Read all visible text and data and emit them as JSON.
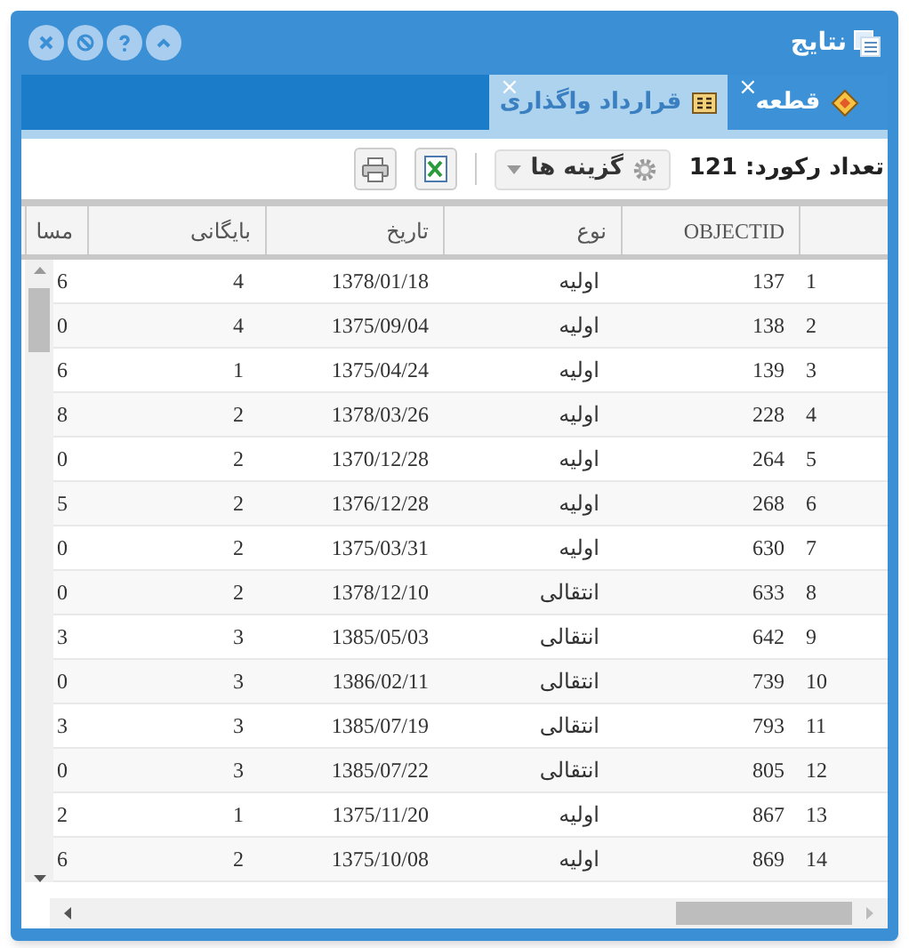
{
  "window": {
    "title": "نتایج"
  },
  "tabs": [
    {
      "label": "قطعه",
      "selected": false,
      "close": "×"
    },
    {
      "label": "قرارداد واگذاری",
      "selected": true,
      "close": "×"
    }
  ],
  "toolbar": {
    "record_count": "تعداد رکورد: 121",
    "options_button": "گزینه ها"
  },
  "table": {
    "columns": [
      "",
      "OBJECTID",
      "نوع",
      "تاریخ",
      "بایگانی",
      "مسا"
    ],
    "rows": [
      [
        "1",
        "137",
        "اولیه",
        "1378/01/18",
        "4",
        "6"
      ],
      [
        "2",
        "138",
        "اولیه",
        "1375/09/04",
        "4",
        "0"
      ],
      [
        "3",
        "139",
        "اولیه",
        "1375/04/24",
        "1",
        "6"
      ],
      [
        "4",
        "228",
        "اولیه",
        "1378/03/26",
        "2",
        "8"
      ],
      [
        "5",
        "264",
        "اولیه",
        "1370/12/28",
        "2",
        "0"
      ],
      [
        "6",
        "268",
        "اولیه",
        "1376/12/28",
        "2",
        "5"
      ],
      [
        "7",
        "630",
        "اولیه",
        "1375/03/31",
        "2",
        "0"
      ],
      [
        "8",
        "633",
        "انتقالی",
        "1378/12/10",
        "2",
        "0"
      ],
      [
        "9",
        "642",
        "انتقالی",
        "1385/05/03",
        "3",
        "3"
      ],
      [
        "10",
        "739",
        "انتقالی",
        "1386/02/11",
        "3",
        "0"
      ],
      [
        "11",
        "793",
        "انتقالی",
        "1385/07/19",
        "3",
        "3"
      ],
      [
        "12",
        "805",
        "انتقالی",
        "1385/07/22",
        "3",
        "0"
      ],
      [
        "13",
        "867",
        "اولیه",
        "1375/11/20",
        "1",
        "2"
      ],
      [
        "14",
        "869",
        "اولیه",
        "1375/10/08",
        "2",
        "6"
      ]
    ]
  }
}
